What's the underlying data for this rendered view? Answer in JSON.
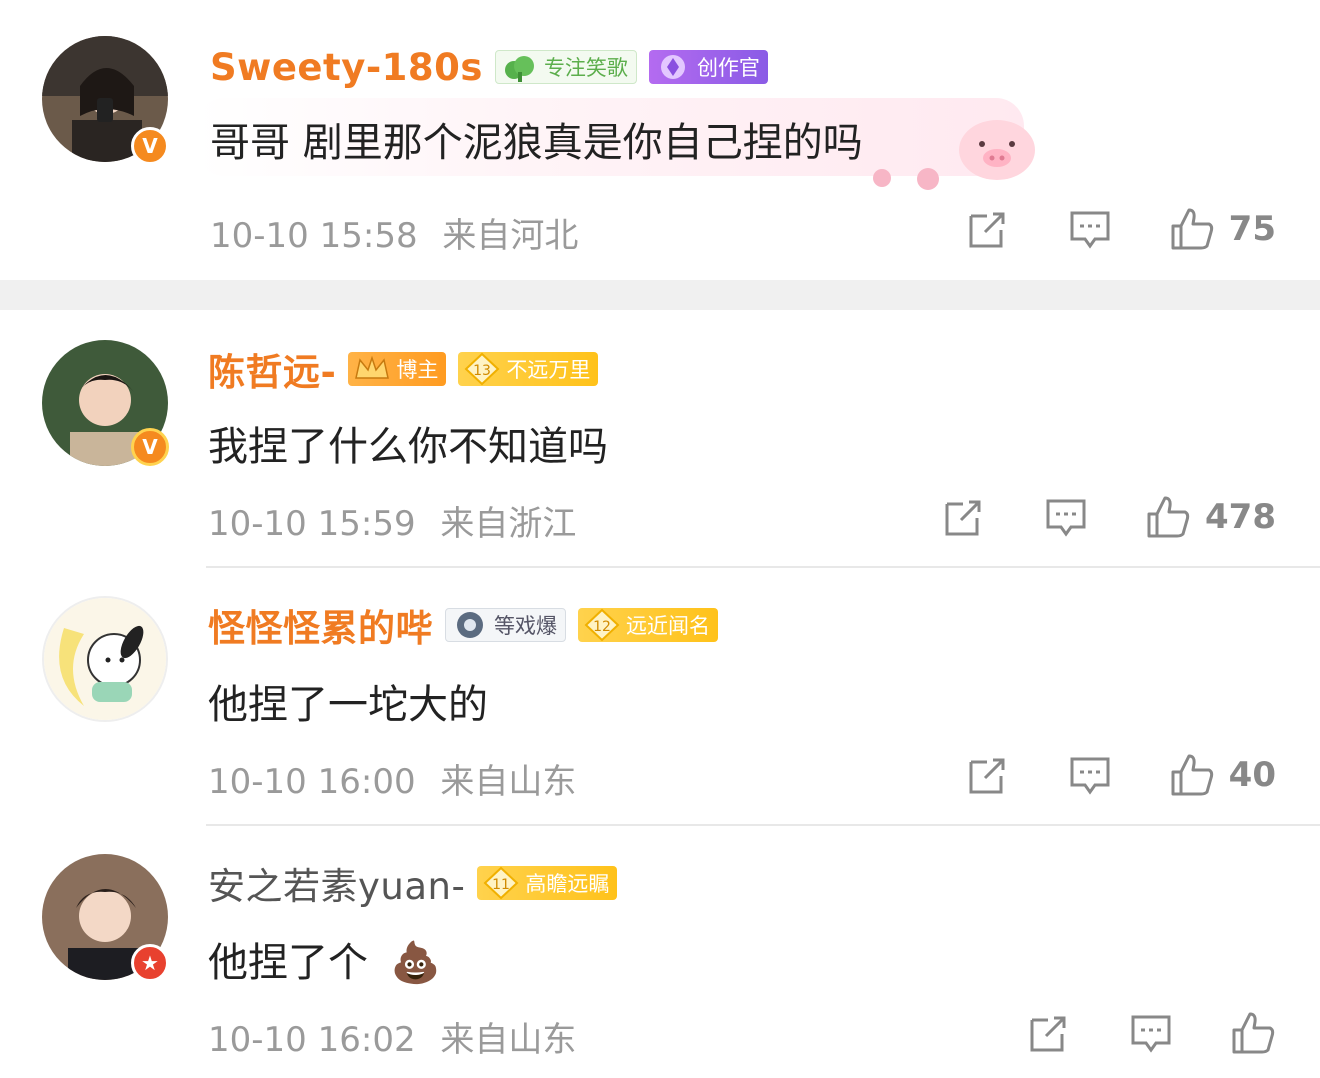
{
  "comments": [
    {
      "username": "Sweety-180s",
      "tags": [
        {
          "label": "专注笑歌",
          "icon": "leaf-icon"
        },
        {
          "label": "创作官",
          "icon": "creator-icon"
        }
      ],
      "text": "哥哥 剧里那个泥狼真是你自己捏的吗",
      "time": "10-10 15:58",
      "location": "来自河北",
      "likes": "75",
      "badge": "V"
    },
    {
      "username": "陈哲远-",
      "tags": [
        {
          "label": "博主",
          "icon": "crown-icon"
        },
        {
          "label": "不远万里",
          "icon": "level-13-icon",
          "level": "13"
        }
      ],
      "text": "我捏了什么你不知道吗",
      "time": "10-10 15:59",
      "location": "来自浙江",
      "likes": "478",
      "badge": "V"
    },
    {
      "username": "怪怪怪累的哔",
      "tags": [
        {
          "label": "等戏爆",
          "icon": "flower-icon"
        },
        {
          "label": "远近闻名",
          "icon": "level-12-icon",
          "level": "12"
        }
      ],
      "text": "他捏了一坨大的",
      "time": "10-10 16:00",
      "location": "来自山东",
      "likes": "40"
    },
    {
      "username": "安之若素yuan-",
      "tags": [
        {
          "label": "高瞻远瞩",
          "icon": "level-11-icon",
          "level": "11"
        }
      ],
      "text": "他捏了个",
      "emoji": "💩",
      "time": "10-10 16:02",
      "location": "来自山东",
      "badge": "★"
    }
  ]
}
